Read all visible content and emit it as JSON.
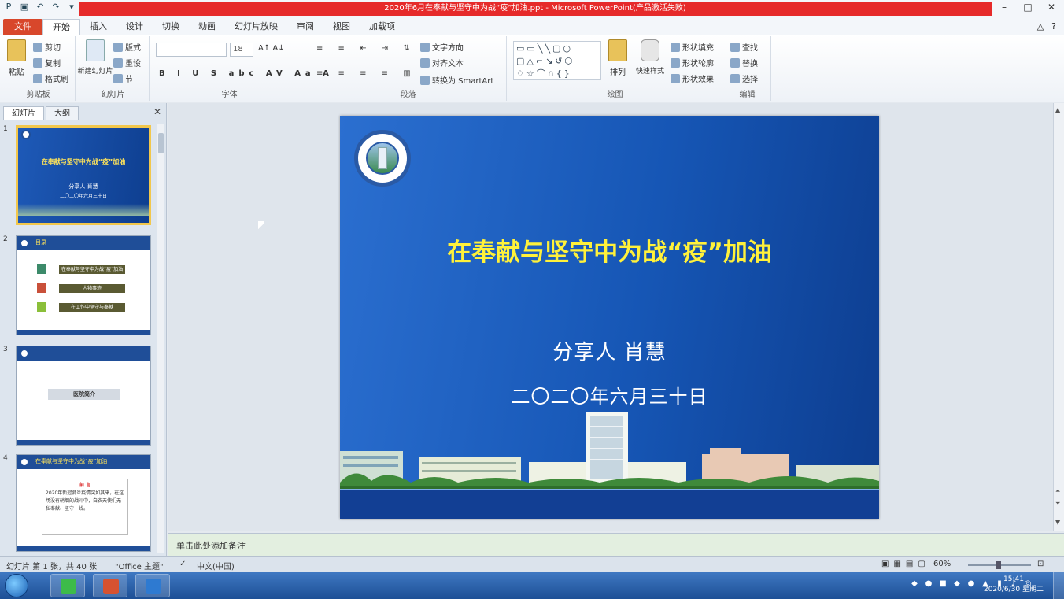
{
  "window": {
    "title": "2020年6月在奉献与坚守中为战“疫”加油.ppt - Microsoft PowerPoint(产品激活失败)",
    "controls": [
      "–",
      "□",
      "✕"
    ]
  },
  "ribbon": {
    "tabs": [
      "文件",
      "开始",
      "插入",
      "设计",
      "切换",
      "动画",
      "幻灯片放映",
      "审阅",
      "视图",
      "加载项"
    ],
    "active_tab": "开始",
    "groups": {
      "clipboard": {
        "label": "剪贴板",
        "paste": "粘贴",
        "cut": "剪切",
        "copy": "复制",
        "format_painter": "格式刷"
      },
      "slides": {
        "label": "幻灯片",
        "new_slide": "新建幻灯片",
        "layout": "版式",
        "reset": "重设",
        "section": "节"
      },
      "font": {
        "label": "字体",
        "font_name": "",
        "font_size": "18"
      },
      "paragraph": {
        "label": "段落",
        "text_direction": "文字方向",
        "align_text": "对齐文本",
        "smartart": "转换为 SmartArt"
      },
      "drawing": {
        "label": "绘图",
        "arrange": "排列",
        "quick_styles": "快速样式",
        "shape_fill": "形状填充",
        "shape_outline": "形状轮廓",
        "shape_effects": "形状效果"
      },
      "editing": {
        "label": "编辑",
        "find": "查找",
        "replace": "替换",
        "select": "选择"
      }
    }
  },
  "left_panel": {
    "tabs": [
      "幻灯片",
      "大纲"
    ],
    "close": "✕",
    "thumbnails": [
      {
        "num": "1",
        "title": "在奉献与坚守中为战“疫”加油",
        "sub1": "分享人  肖慧",
        "sub2": "二〇二〇年六月三十日"
      },
      {
        "num": "2",
        "title": "目录",
        "items": [
          "在奉献与坚守中为战“疫”加油",
          "人物事迹",
          "在工作中坚守与奉献"
        ]
      },
      {
        "num": "3",
        "center": "医院简介"
      },
      {
        "num": "4",
        "title": "在奉献与坚守中为战“疫”加油",
        "card_head": "前 言",
        "card_body": "2020年新冠肺炎疫情突如其来，在这场没有硝烟的战斗中，白衣天使们无私奉献、坚守一线。"
      }
    ]
  },
  "slide": {
    "title": "在奉献与坚守中为战“疫”加油",
    "presenter": "分享人   肖慧",
    "date": "二〇二〇年六月三十日"
  },
  "notes": {
    "placeholder": "单击此处添加备注"
  },
  "statusbar": {
    "slide_info": "幻灯片 第 1 张，共 40 张",
    "theme": "\"Office 主题\"",
    "language": "中文(中国)",
    "zoom": "60%"
  },
  "taskbar": {
    "time": "15:41",
    "date": "2020/6/30 星期二"
  }
}
